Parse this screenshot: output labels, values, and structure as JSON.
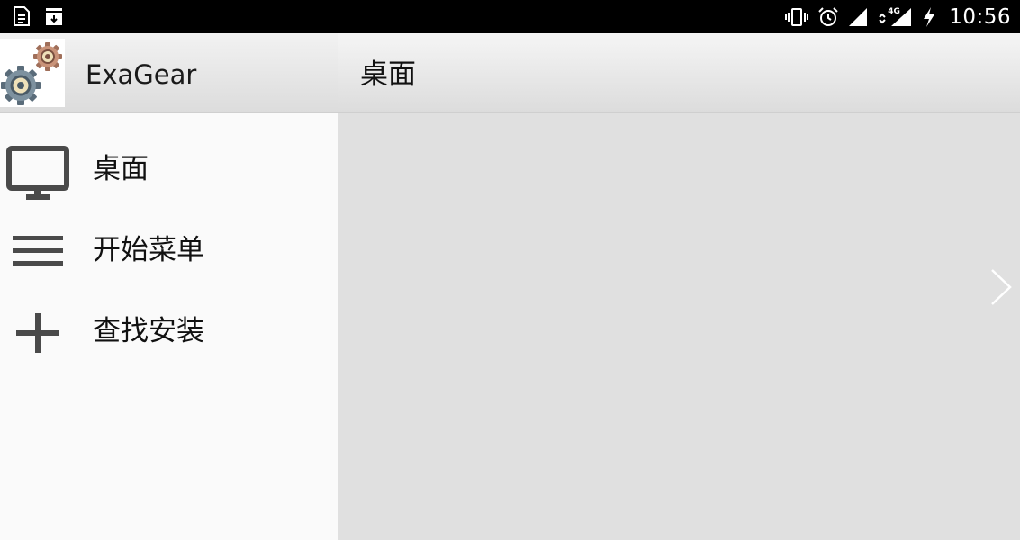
{
  "status_bar": {
    "time": "10:56",
    "network_label": "4G",
    "left_icons": [
      "document-icon",
      "download-icon"
    ],
    "right_icons": [
      "vibrate-icon",
      "alarm-icon",
      "signal-icon",
      "mobile-signal-4g-icon",
      "charging-icon"
    ]
  },
  "drawer": {
    "app_title": "ExaGear",
    "app_icon": "gears-icon",
    "items": [
      {
        "label": "桌面",
        "icon": "monitor-icon"
      },
      {
        "label": "开始菜单",
        "icon": "hamburger-menu-icon"
      },
      {
        "label": "查找安装",
        "icon": "plus-icon"
      }
    ]
  },
  "content": {
    "title": "桌面",
    "next_icon": "chevron-right-icon"
  },
  "colors": {
    "status_bar_bg": "#000000",
    "drawer_bg": "#fafafa",
    "content_bg": "#e0e0e0",
    "icon_gray": "#4a4a4a"
  }
}
